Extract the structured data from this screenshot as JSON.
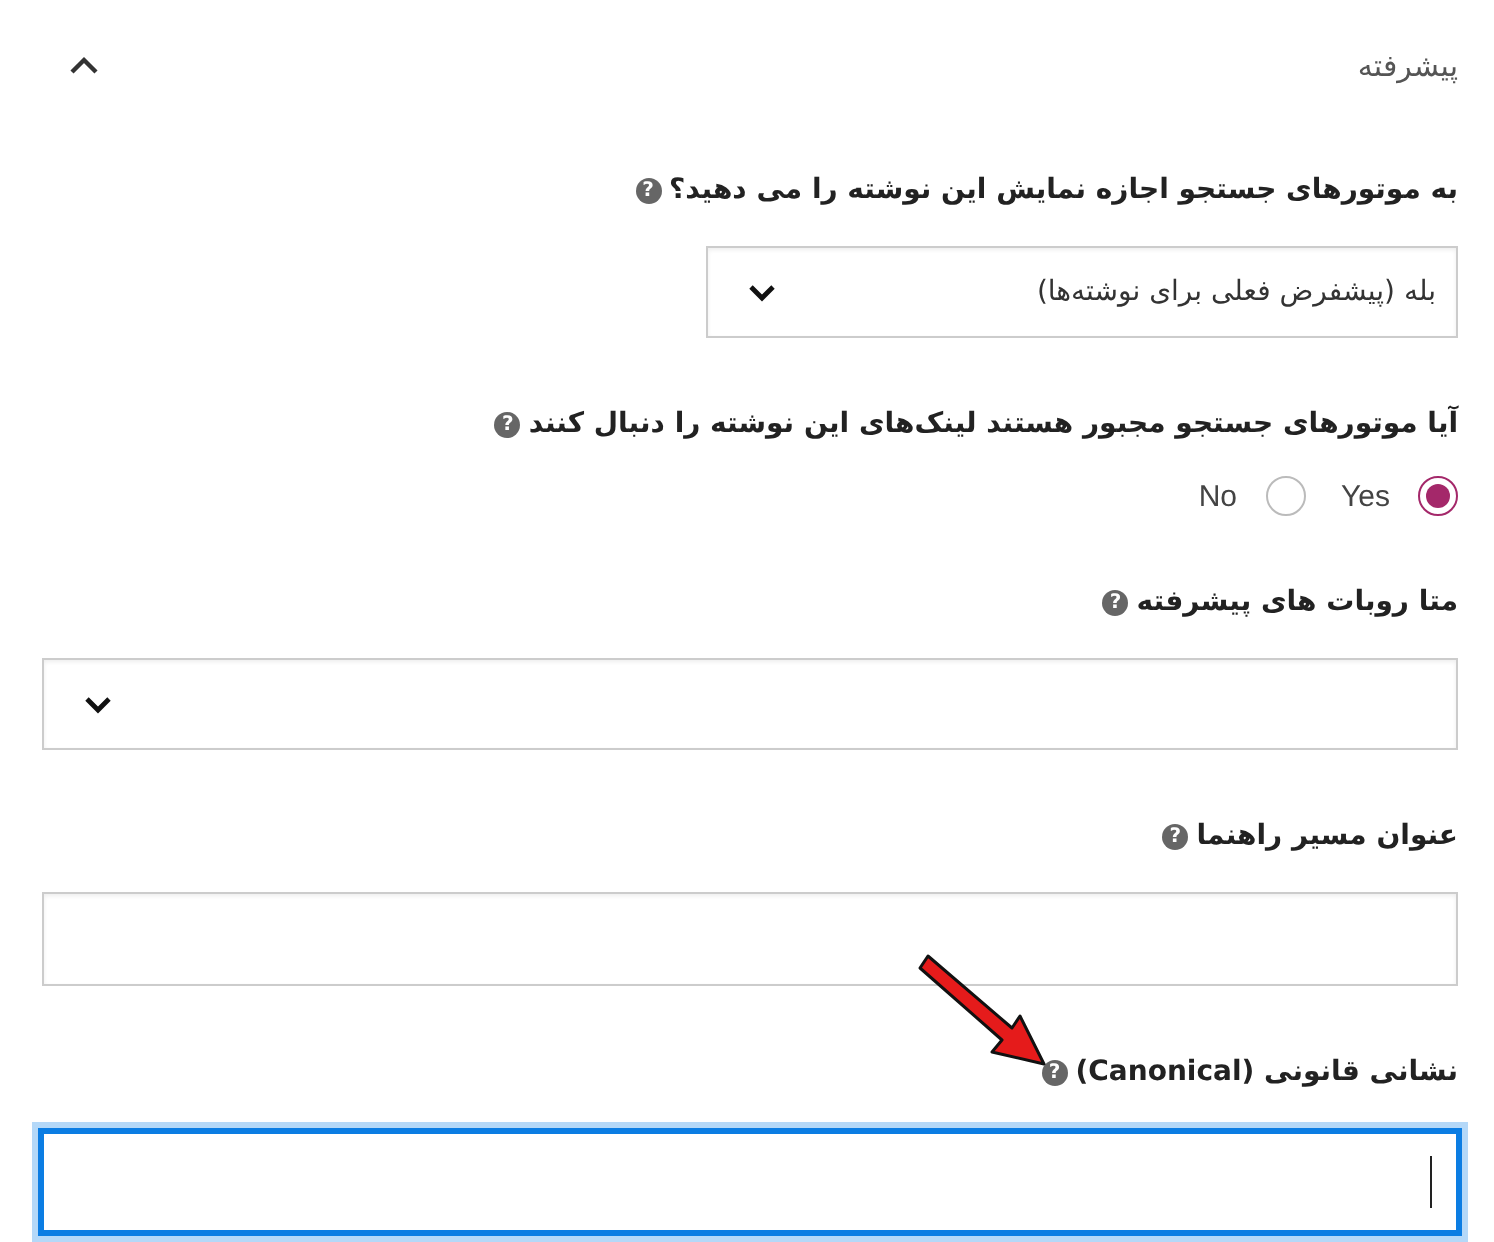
{
  "section": {
    "title": "پیشرفته",
    "expanded": true
  },
  "fields": [
    {
      "kind": "select",
      "label": "به موتورهای جستجو اجازه نمایش این نوشته را می دهید؟",
      "help": "?",
      "value": "بله (پیشفرض فعلی برای نوشته‌ها)",
      "wide": false
    },
    {
      "kind": "radio",
      "label": "آیا موتورهای جستجو مجبور هستند لینک‌های این نوشته را دنبال کنند",
      "help": "?",
      "options": [
        {
          "label": "Yes",
          "selected": true
        },
        {
          "label": "No",
          "selected": false
        }
      ]
    },
    {
      "kind": "select",
      "label": "متا روبات های پیشرفته",
      "help": "?",
      "wide": true
    },
    {
      "kind": "text",
      "label": "عنوان مسیر راهنما",
      "help": "?",
      "focused": false
    },
    {
      "kind": "text",
      "label": "نشانی قانونی (Canonical)",
      "help": "?",
      "focused": true
    }
  ],
  "annotation_arrow": true
}
